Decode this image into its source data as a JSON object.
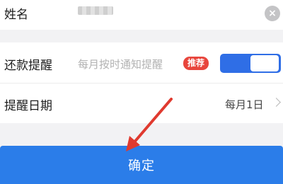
{
  "name_row": {
    "label": "姓名",
    "clear_icon": "clear-icon",
    "clear_glyph": "×"
  },
  "reminder": {
    "label": "还款提醒",
    "hint": "每月按时通知提醒",
    "badge": "推荐",
    "toggle_on": true
  },
  "reminder_date": {
    "label": "提醒日期",
    "value": "每月1日",
    "chevron_icon": "chevron-right-icon"
  },
  "confirm_button": {
    "label": "确定"
  },
  "colors": {
    "accent": "#2b7de9",
    "toggle": "#2f6ee6",
    "badge": "#e8453c",
    "annotation_arrow": "#e03a2f"
  }
}
